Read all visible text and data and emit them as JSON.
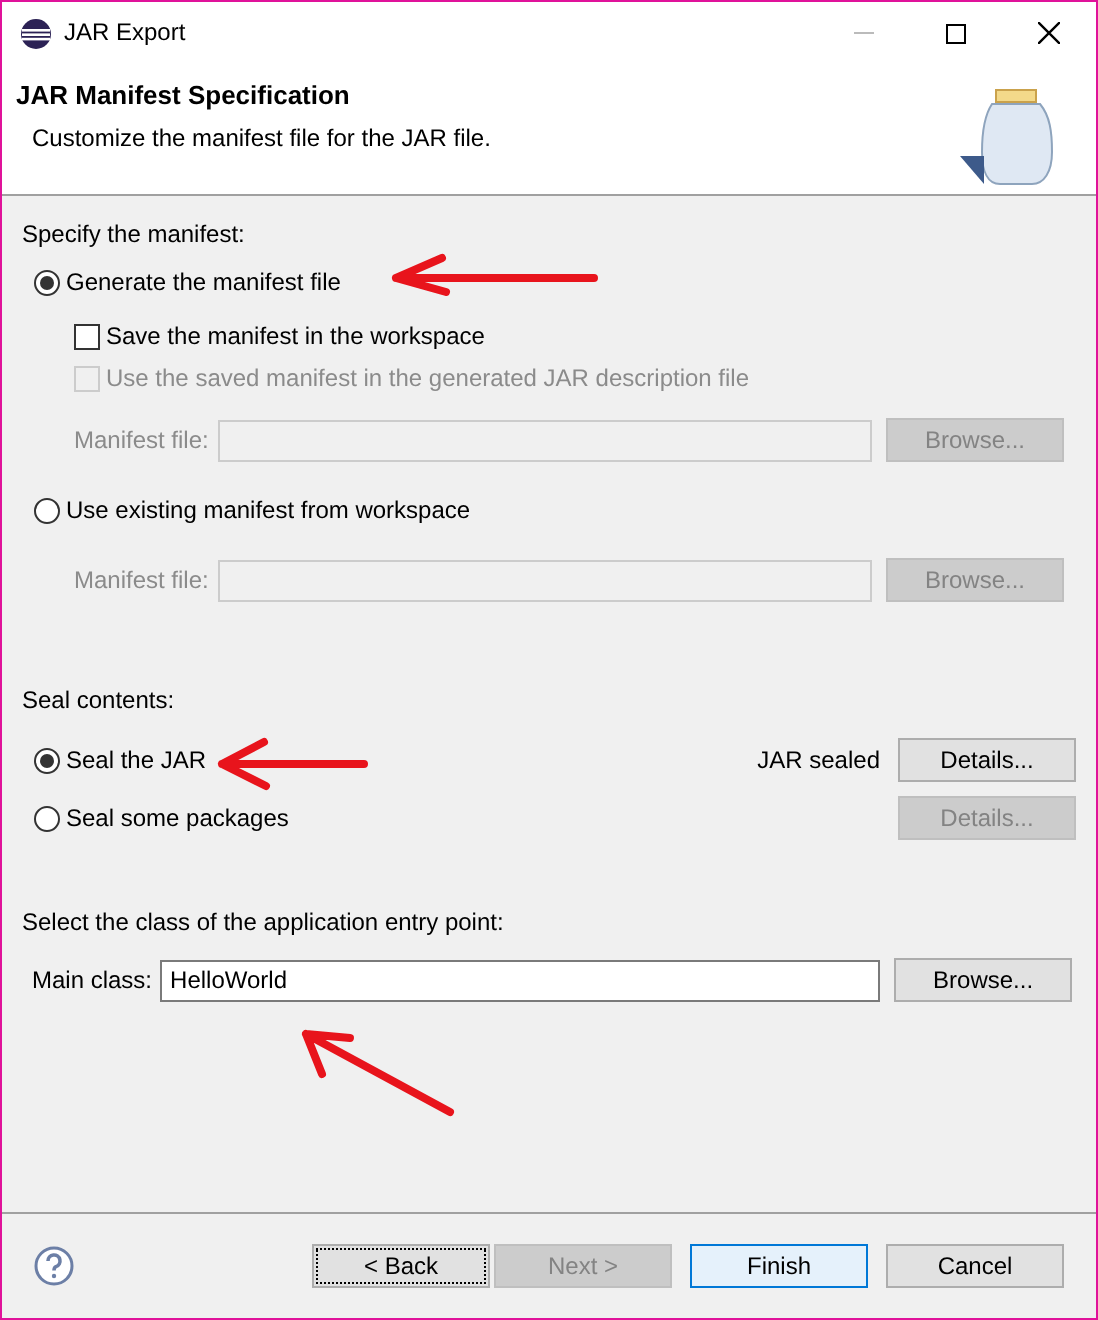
{
  "window": {
    "title": "JAR Export"
  },
  "header": {
    "title": "JAR Manifest Specification",
    "description": "Customize the manifest file for the JAR file."
  },
  "manifest": {
    "heading": "Specify the manifest:",
    "items": [
      {
        "kind": "radio",
        "label": "Generate the manifest file",
        "selected": true,
        "disabled": false
      },
      {
        "kind": "checkbox",
        "label": "Save the manifest in the workspace",
        "checked": false,
        "disabled": false
      },
      {
        "kind": "checkbox",
        "label": "Use the saved manifest in the generated JAR description file",
        "checked": false,
        "disabled": true
      },
      {
        "kind": "file",
        "label": "Manifest file:",
        "value": "",
        "button": "Browse...",
        "disabled": true
      },
      {
        "kind": "radio",
        "label": "Use existing manifest from workspace",
        "selected": false,
        "disabled": false
      },
      {
        "kind": "file",
        "label": "Manifest file:",
        "button": "Browse...",
        "disabled": true
      }
    ]
  },
  "seal": {
    "heading": "Seal contents:",
    "items": [
      {
        "label": "Seal the JAR",
        "selected": true,
        "status": "JAR sealed",
        "button": "Details...",
        "button_disabled": false
      },
      {
        "label": "Seal some packages",
        "selected": false,
        "button": "Details...",
        "button_disabled": true
      }
    ]
  },
  "entry_point": {
    "heading": "Select the class of the application entry point:",
    "label": "Main class:",
    "value": "HelloWorld",
    "button": "Browse..."
  },
  "buttons": [
    {
      "label": "< Back",
      "disabled": false,
      "focused": true,
      "default": false
    },
    {
      "label": "Next >",
      "disabled": true,
      "focused": false,
      "default": false
    },
    {
      "label": "Finish",
      "disabled": false,
      "focused": false,
      "default": true
    },
    {
      "label": "Cancel",
      "disabled": false,
      "focused": false,
      "default": false
    }
  ]
}
